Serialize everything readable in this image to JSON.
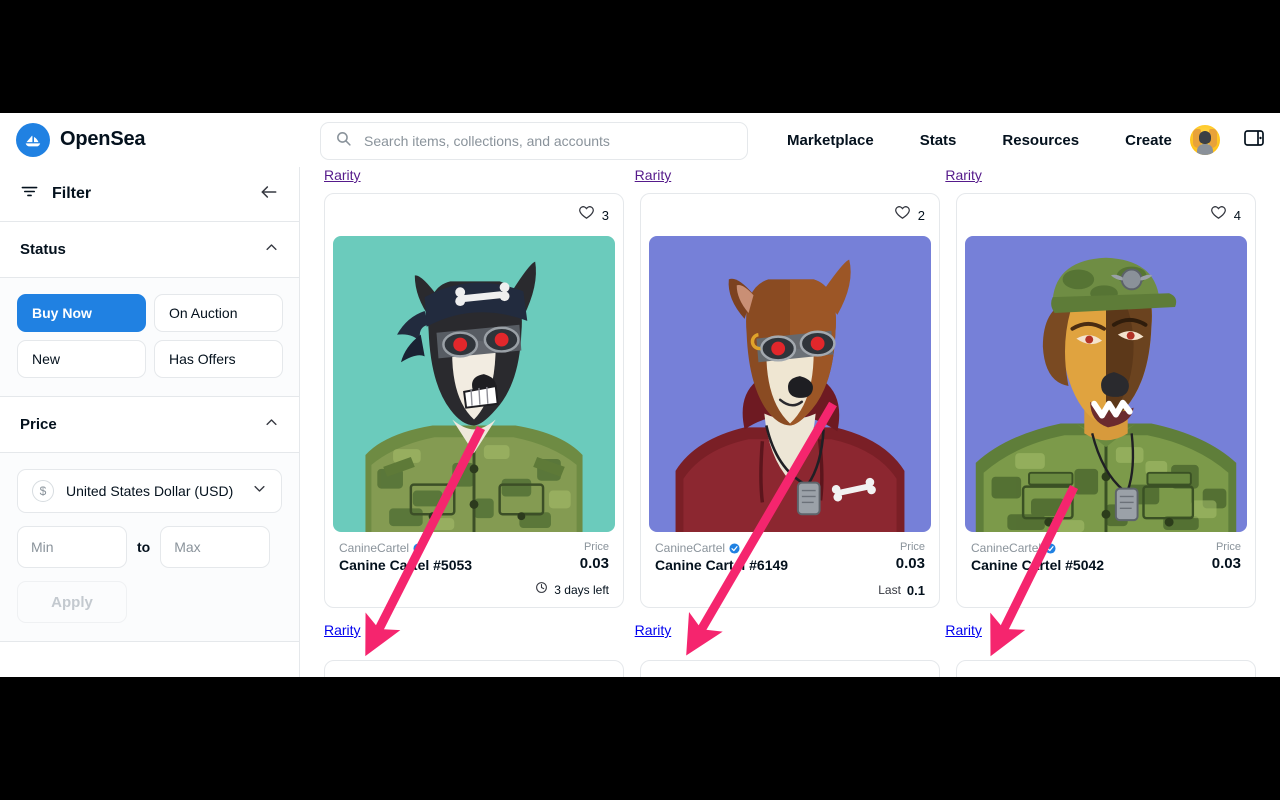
{
  "header": {
    "brand": "OpenSea",
    "logo_icon": "opensea-sailboat-icon",
    "search_placeholder": "Search items, collections, and accounts",
    "search_value": "",
    "search_icon": "search-icon",
    "nav": [
      {
        "label": "Marketplace"
      },
      {
        "label": "Stats"
      },
      {
        "label": "Resources"
      },
      {
        "label": "Create"
      }
    ],
    "avatar_icon": "user-avatar",
    "wallet_icon": "wallet-icon",
    "brand_color": "#2081E2"
  },
  "sidebar": {
    "title": "Filter",
    "filter_icon": "filter-icon",
    "collapse_icon": "arrow-left-icon",
    "sections": [
      {
        "label": "Status",
        "chevron": "chevron-up-icon",
        "chips": [
          {
            "label": "Buy Now",
            "active": true
          },
          {
            "label": "On Auction",
            "active": false
          },
          {
            "label": "New",
            "active": false
          },
          {
            "label": "Has Offers",
            "active": false
          }
        ]
      },
      {
        "label": "Price",
        "chevron": "chevron-up-icon",
        "currency": {
          "icon": "dollar-icon",
          "symbol": "$",
          "selected": "United States Dollar (USD)",
          "chevron": "chevron-down-icon"
        },
        "min_placeholder": "Min",
        "min_value": "",
        "to_label": "to",
        "max_placeholder": "Max",
        "max_value": "",
        "apply_label": "Apply",
        "apply_disabled": true
      }
    ]
  },
  "main": {
    "rarity_link_label": "Rarity",
    "cards": [
      {
        "likes": "3",
        "heart_icon": "heart-icon",
        "collection": "CanineCartel",
        "verified_icon": "verified-badge-icon",
        "name": "Canine Cartel #5053",
        "price_label": "Price",
        "price": "0.03",
        "footer_icon": "clock-icon",
        "footer_text": "3 days left",
        "footer_label": "",
        "footer_value": "",
        "bg_color": "#6BCBBC"
      },
      {
        "likes": "2",
        "heart_icon": "heart-icon",
        "collection": "CanineCartel",
        "verified_icon": "verified-badge-icon",
        "name": "Canine Cartel #6149",
        "price_label": "Price",
        "price": "0.03",
        "footer_icon": "",
        "footer_text": "",
        "footer_label": "Last",
        "footer_value": "0.1",
        "bg_color": "#7680D8"
      },
      {
        "likes": "4",
        "heart_icon": "heart-icon",
        "collection": "CanineCartel",
        "verified_icon": "verified-badge-icon",
        "name": "Canine Cartel #5042",
        "price_label": "Price",
        "price": "0.03",
        "footer_icon": "",
        "footer_text": "",
        "footer_label": "",
        "footer_value": "",
        "bg_color": "#7680D8"
      }
    ]
  },
  "annotations": {
    "arrow_color": "#F5256E",
    "arrows": [
      {
        "name": "arrow-to-rarity-card-1"
      },
      {
        "name": "arrow-to-rarity-card-2"
      },
      {
        "name": "arrow-to-rarity-card-3"
      }
    ]
  }
}
